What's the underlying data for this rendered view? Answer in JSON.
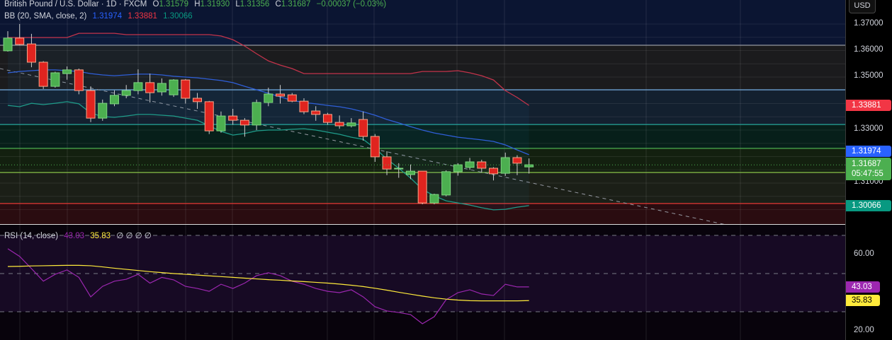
{
  "header": {
    "symbol": "British Pound / U.S. Dollar · 1D · FXCM",
    "open_label": "O",
    "open": "1.31579",
    "high_label": "H",
    "high": "1.31930",
    "low_label": "L",
    "low": "1.31356",
    "close_label": "C",
    "close": "1.31687",
    "change": "−0.00037 (−0.03%)"
  },
  "bb": {
    "label": "BB (20, SMA, close, 2)",
    "basis": "1.31974",
    "upper": "1.33881",
    "lower": "1.30066"
  },
  "rsi": {
    "label": "RSI (14, close)",
    "value": "43.03",
    "ma": "35.83",
    "extras": "∅ ∅ ∅ ∅"
  },
  "axis": {
    "currency": "USD",
    "price_ticks": [
      "1.37000",
      "1.36000",
      "1.35000",
      "1.33000",
      "1.31000"
    ],
    "rsi_ticks": [
      "60.00",
      "20.00"
    ],
    "tags": {
      "upper": "1.33881",
      "basis": "1.31974",
      "last": "1.31687",
      "countdown": "05:47:55",
      "lower": "1.30066",
      "rsi": "43.03",
      "rsi_ma": "35.83"
    }
  },
  "colors": {
    "up": "#4caf50",
    "down": "#e0241f",
    "upper": "#c2334a",
    "basis": "#2f5fd8",
    "lower": "#1f9c8a",
    "rsi": "#9c27b0",
    "rsi_ma": "#ffeb3b"
  },
  "chart_data": {
    "type": "candlestick",
    "ylim": [
      1.2925,
      1.3726
    ],
    "levels": [
      1.362,
      1.3452,
      1.3321,
      1.3231,
      1.314,
      1.3023
    ],
    "candles": [
      [
        1.3599,
        1.3673,
        1.3596,
        1.3647
      ],
      [
        1.3647,
        1.37,
        1.362,
        1.3623
      ],
      [
        1.3625,
        1.3663,
        1.3537,
        1.3556
      ],
      [
        1.3556,
        1.356,
        1.3455,
        1.3465
      ],
      [
        1.3465,
        1.352,
        1.346,
        1.3516
      ],
      [
        1.3513,
        1.354,
        1.349,
        1.3527
      ],
      [
        1.3527,
        1.3532,
        1.3435,
        1.3449
      ],
      [
        1.3449,
        1.3465,
        1.333,
        1.3345
      ],
      [
        1.3345,
        1.3415,
        1.3335,
        1.3401
      ],
      [
        1.3399,
        1.345,
        1.339,
        1.3431
      ],
      [
        1.3431,
        1.347,
        1.342,
        1.3449
      ],
      [
        1.3449,
        1.3529,
        1.3435,
        1.3479
      ],
      [
        1.3479,
        1.3513,
        1.3404,
        1.3441
      ],
      [
        1.3444,
        1.3495,
        1.343,
        1.3476
      ],
      [
        1.3433,
        1.3492,
        1.3425,
        1.3489
      ],
      [
        1.3489,
        1.3492,
        1.34,
        1.342
      ],
      [
        1.342,
        1.344,
        1.338,
        1.3407
      ],
      [
        1.3407,
        1.341,
        1.3285,
        1.3297
      ],
      [
        1.3297,
        1.337,
        1.329,
        1.3353
      ],
      [
        1.3353,
        1.338,
        1.332,
        1.3337
      ],
      [
        1.3337,
        1.3345,
        1.3275,
        1.3319
      ],
      [
        1.3319,
        1.3415,
        1.33,
        1.3404
      ],
      [
        1.3404,
        1.346,
        1.339,
        1.3436
      ],
      [
        1.3436,
        1.347,
        1.34,
        1.3428
      ],
      [
        1.3433,
        1.344,
        1.3405,
        1.3409
      ],
      [
        1.3409,
        1.342,
        1.336,
        1.3369
      ],
      [
        1.3372,
        1.339,
        1.3335,
        1.3359
      ],
      [
        1.3359,
        1.3365,
        1.332,
        1.3329
      ],
      [
        1.3329,
        1.3355,
        1.3305,
        1.3316
      ],
      [
        1.3316,
        1.3345,
        1.331,
        1.3327
      ],
      [
        1.334,
        1.337,
        1.326,
        1.3276
      ],
      [
        1.3276,
        1.3285,
        1.318,
        1.3199
      ],
      [
        1.3199,
        1.322,
        1.313,
        1.3153
      ],
      [
        1.3156,
        1.3175,
        1.312,
        1.3156
      ],
      [
        1.3132,
        1.317,
        1.3115,
        1.3145
      ],
      [
        1.3145,
        1.3145,
        1.302,
        1.3025
      ],
      [
        1.3025,
        1.306,
        1.302,
        1.3057
      ],
      [
        1.3055,
        1.3148,
        1.305,
        1.3143
      ],
      [
        1.3143,
        1.3175,
        1.3128,
        1.3169
      ],
      [
        1.3159,
        1.3195,
        1.315,
        1.318
      ],
      [
        1.318,
        1.3188,
        1.314,
        1.3156
      ],
      [
        1.3156,
        1.316,
        1.311,
        1.3135
      ],
      [
        1.3137,
        1.3215,
        1.3127,
        1.3196
      ],
      [
        1.3196,
        1.3205,
        1.313,
        1.3175
      ],
      [
        1.3161,
        1.3193,
        1.3136,
        1.3169
      ]
    ],
    "bb_upper": [
      1.3649,
      1.3649,
      1.3649,
      1.3649,
      1.3649,
      1.3649,
      1.3665,
      1.3665,
      1.3665,
      1.3665,
      1.366,
      1.366,
      1.366,
      1.366,
      1.366,
      1.366,
      1.366,
      1.366,
      1.3655,
      1.3641,
      1.3617,
      1.3588,
      1.3561,
      1.3545,
      1.3532,
      1.3513,
      1.3513,
      1.3513,
      1.3513,
      1.3513,
      1.3513,
      1.3513,
      1.3513,
      1.3513,
      1.3513,
      1.3521,
      1.3521,
      1.3521,
      1.3524,
      1.3516,
      1.3505,
      1.3489,
      1.3449,
      1.3423,
      1.3393
    ],
    "bb_basis": [
      1.3516,
      1.3521,
      1.3524,
      1.3527,
      1.3527,
      1.3524,
      1.3521,
      1.3513,
      1.3508,
      1.3505,
      1.3508,
      1.3511,
      1.3511,
      1.3508,
      1.3503,
      1.35,
      1.3497,
      1.3492,
      1.3487,
      1.3479,
      1.3465,
      1.3452,
      1.3439,
      1.3425,
      1.3412,
      1.3404,
      1.3399,
      1.3393,
      1.3388,
      1.338,
      1.3369,
      1.3356,
      1.334,
      1.3327,
      1.3313,
      1.33,
      1.3289,
      1.3281,
      1.3273,
      1.3268,
      1.3263,
      1.3257,
      1.3244,
      1.3225,
      1.3207
    ],
    "bb_lower": [
      1.3393,
      1.3388,
      1.3401,
      1.3396,
      1.3401,
      1.3407,
      1.3399,
      1.3364,
      1.3351,
      1.3348,
      1.3353,
      1.3359,
      1.3359,
      1.3356,
      1.3353,
      1.3345,
      1.3337,
      1.3316,
      1.3295,
      1.3281,
      1.3287,
      1.3297,
      1.33,
      1.33,
      1.3303,
      1.3305,
      1.33,
      1.3292,
      1.3284,
      1.3273,
      1.3265,
      1.3231,
      1.3191,
      1.3156,
      1.3119,
      1.3076,
      1.3052,
      1.3033,
      1.3025,
      1.3017,
      1.3007,
      1.2999,
      1.3001,
      1.3009,
      1.3015
    ],
    "rsi_ylim": [
      15,
      76
    ],
    "rsi_levels": [
      70,
      50,
      30
    ],
    "rsi_values": [
      63,
      59,
      52.6,
      46,
      49.6,
      51.9,
      48,
      37.8,
      43.3,
      46,
      47,
      49.6,
      45,
      48,
      46.7,
      43.3,
      42.2,
      40.7,
      44.4,
      42.2,
      45,
      48.9,
      50.4,
      48.9,
      46,
      44.4,
      42.2,
      40.7,
      40,
      41.5,
      37.8,
      32.6,
      30.4,
      29.6,
      28.5,
      23.7,
      27.4,
      36.3,
      40,
      41.5,
      39.3,
      38.5,
      44.4,
      43,
      43
    ],
    "rsi_ma": [
      53.7,
      53.8,
      54,
      54.1,
      54.2,
      54.3,
      54.3,
      54.1,
      53.5,
      52.8,
      52.2,
      51.6,
      51,
      50.5,
      50,
      49.6,
      49.2,
      48.8,
      48.4,
      48,
      47.6,
      47.2,
      46.8,
      46.5,
      46.1,
      45.8,
      45.4,
      45,
      44.5,
      43.9,
      43.2,
      42.3,
      41.3,
      40.2,
      39.2,
      38.2,
      37.3,
      36.6,
      36.1,
      35.8,
      35.7,
      35.7,
      35.7,
      35.7,
      35.83
    ]
  }
}
